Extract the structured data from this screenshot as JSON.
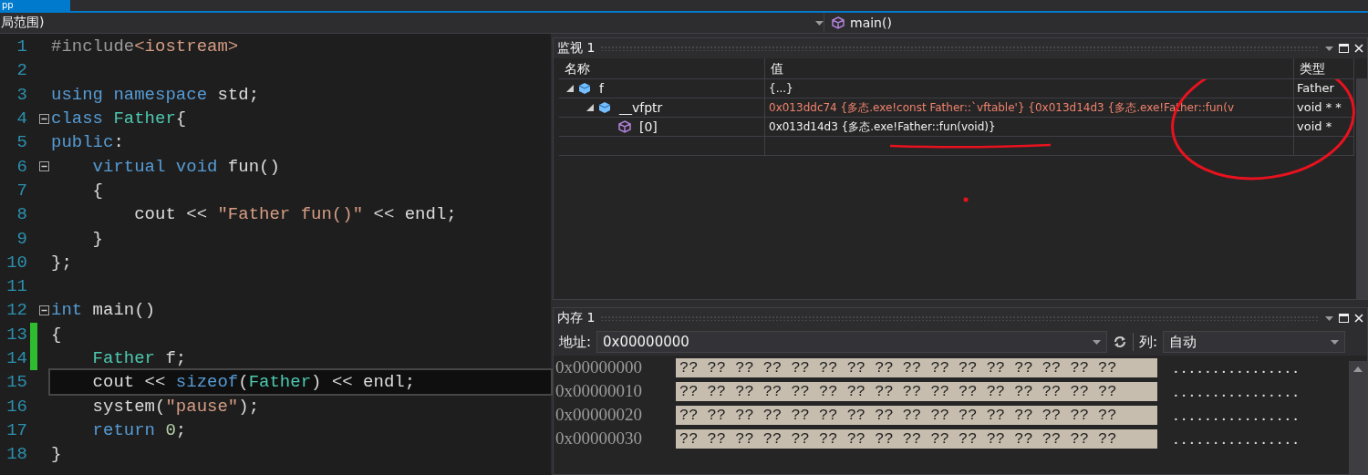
{
  "tabs": [
    {
      "label": "pp",
      "selected": true
    }
  ],
  "nav": {
    "scope": "局范围)",
    "function": "main()"
  },
  "editor": {
    "lines": [
      {
        "number": "1",
        "fold": false,
        "changed": false,
        "current": false,
        "tokens": [
          {
            "kind": "pre",
            "text": "#include"
          },
          {
            "kind": "str",
            "text": "<iostream>"
          }
        ]
      },
      {
        "number": "2",
        "fold": false,
        "changed": false,
        "current": false
      },
      {
        "number": "3",
        "fold": false,
        "changed": false,
        "current": false,
        "tokens": [
          {
            "kind": "kw",
            "text": "using namespace"
          },
          {
            "kind": "plain",
            "text": " std;"
          }
        ]
      },
      {
        "number": "4",
        "fold": true,
        "changed": false,
        "current": false,
        "tokens": [
          {
            "kind": "kw",
            "text": "class"
          },
          {
            "kind": "type",
            "text": " Father"
          },
          {
            "kind": "plain",
            "text": "{"
          }
        ]
      },
      {
        "number": "5",
        "fold": false,
        "changed": false,
        "current": false,
        "tokens": [
          {
            "kind": "kw",
            "text": "public"
          },
          {
            "kind": "plain",
            "text": ":"
          }
        ]
      },
      {
        "number": "6",
        "fold": true,
        "changed": false,
        "current": false,
        "tokens": [
          {
            "kind": "kw",
            "text": "    virtual void"
          },
          {
            "kind": "plain",
            "text": " fun()"
          }
        ]
      },
      {
        "number": "7",
        "fold": false,
        "changed": false,
        "current": false,
        "tokens": [
          {
            "kind": "plain",
            "text": "    {"
          }
        ]
      },
      {
        "number": "8",
        "fold": false,
        "changed": false,
        "current": false,
        "tokens": [
          {
            "kind": "plain",
            "text": "        cout << "
          },
          {
            "kind": "str",
            "text": "\"Father fun()\""
          },
          {
            "kind": "plain",
            "text": " << endl;"
          }
        ]
      },
      {
        "number": "9",
        "fold": false,
        "changed": false,
        "current": false,
        "tokens": [
          {
            "kind": "plain",
            "text": "    }"
          }
        ]
      },
      {
        "number": "10",
        "fold": false,
        "changed": false,
        "current": false,
        "tokens": [
          {
            "kind": "plain",
            "text": "};"
          }
        ]
      },
      {
        "number": "11",
        "fold": false,
        "changed": false,
        "current": false
      },
      {
        "number": "12",
        "fold": true,
        "changed": false,
        "current": false,
        "tokens": [
          {
            "kind": "kw",
            "text": "int"
          },
          {
            "kind": "plain",
            "text": " main()"
          }
        ]
      },
      {
        "number": "13",
        "fold": false,
        "changed": true,
        "current": false,
        "tokens": [
          {
            "kind": "plain",
            "text": "{"
          }
        ]
      },
      {
        "number": "14",
        "fold": false,
        "changed": true,
        "current": false,
        "tokens": [
          {
            "kind": "type",
            "text": "    Father"
          },
          {
            "kind": "plain",
            "text": " f;"
          }
        ]
      },
      {
        "number": "15",
        "fold": false,
        "changed": false,
        "current": true,
        "tokens": [
          {
            "kind": "plain",
            "text": "    cout << "
          },
          {
            "kind": "kw",
            "text": "sizeof"
          },
          {
            "kind": "plain",
            "text": "("
          },
          {
            "kind": "type",
            "text": "Father"
          },
          {
            "kind": "plain",
            "text": ") << endl;"
          }
        ]
      },
      {
        "number": "16",
        "fold": false,
        "changed": false,
        "current": false,
        "tokens": [
          {
            "kind": "plain",
            "text": "    system("
          },
          {
            "kind": "str",
            "text": "\"pause\""
          },
          {
            "kind": "plain",
            "text": ");"
          }
        ]
      },
      {
        "number": "17",
        "fold": false,
        "changed": false,
        "current": false,
        "tokens": [
          {
            "kind": "kw",
            "text": "    return"
          },
          {
            "kind": "num",
            "text": " 0"
          },
          {
            "kind": "plain",
            "text": ";"
          }
        ]
      },
      {
        "number": "18",
        "fold": false,
        "changed": false,
        "current": false,
        "tokens": [
          {
            "kind": "plain",
            "text": "}"
          }
        ]
      }
    ]
  },
  "watch": {
    "title": "监视 1",
    "columns": [
      "名称",
      "值",
      "类型"
    ],
    "rows": [
      {
        "name": "f",
        "value": "{...}",
        "type": "Father",
        "kind": "object",
        "expanded": true,
        "changed": false,
        "children": [
          {
            "name": "__vfptr",
            "value": "0x013ddc74 {多态.exe!const Father::`vftable'} {0x013d14d3 {多态.exe!Father::fun(v",
            "type": "void * *",
            "kind": "object",
            "expanded": true,
            "changed": true,
            "children": [
              {
                "name": "[0]",
                "value": "0x013d14d3 {多态.exe!Father::fun(void)}",
                "type": "void *",
                "kind": "method",
                "changed": false
              }
            ]
          }
        ]
      }
    ]
  },
  "memory": {
    "title": "内存 1",
    "address_label": "地址:",
    "address": "0x00000000",
    "columns_label": "列:",
    "columns_value": "自动",
    "rows": [
      {
        "address": "0x00000000",
        "bytes": "?? ?? ?? ?? ?? ?? ?? ?? ?? ?? ?? ?? ?? ?? ?? ??",
        "ascii": "................"
      },
      {
        "address": "0x00000010",
        "bytes": "?? ?? ?? ?? ?? ?? ?? ?? ?? ?? ?? ?? ?? ?? ?? ??",
        "ascii": "................"
      },
      {
        "address": "0x00000020",
        "bytes": "?? ?? ?? ?? ?? ?? ?? ?? ?? ?? ?? ?? ?? ?? ?? ??",
        "ascii": "................"
      },
      {
        "address": "0x00000030",
        "bytes": "?? ?? ?? ?? ?? ?? ?? ?? ?? ?? ?? ?? ?? ?? ?? ??",
        "ascii": "................"
      }
    ]
  }
}
